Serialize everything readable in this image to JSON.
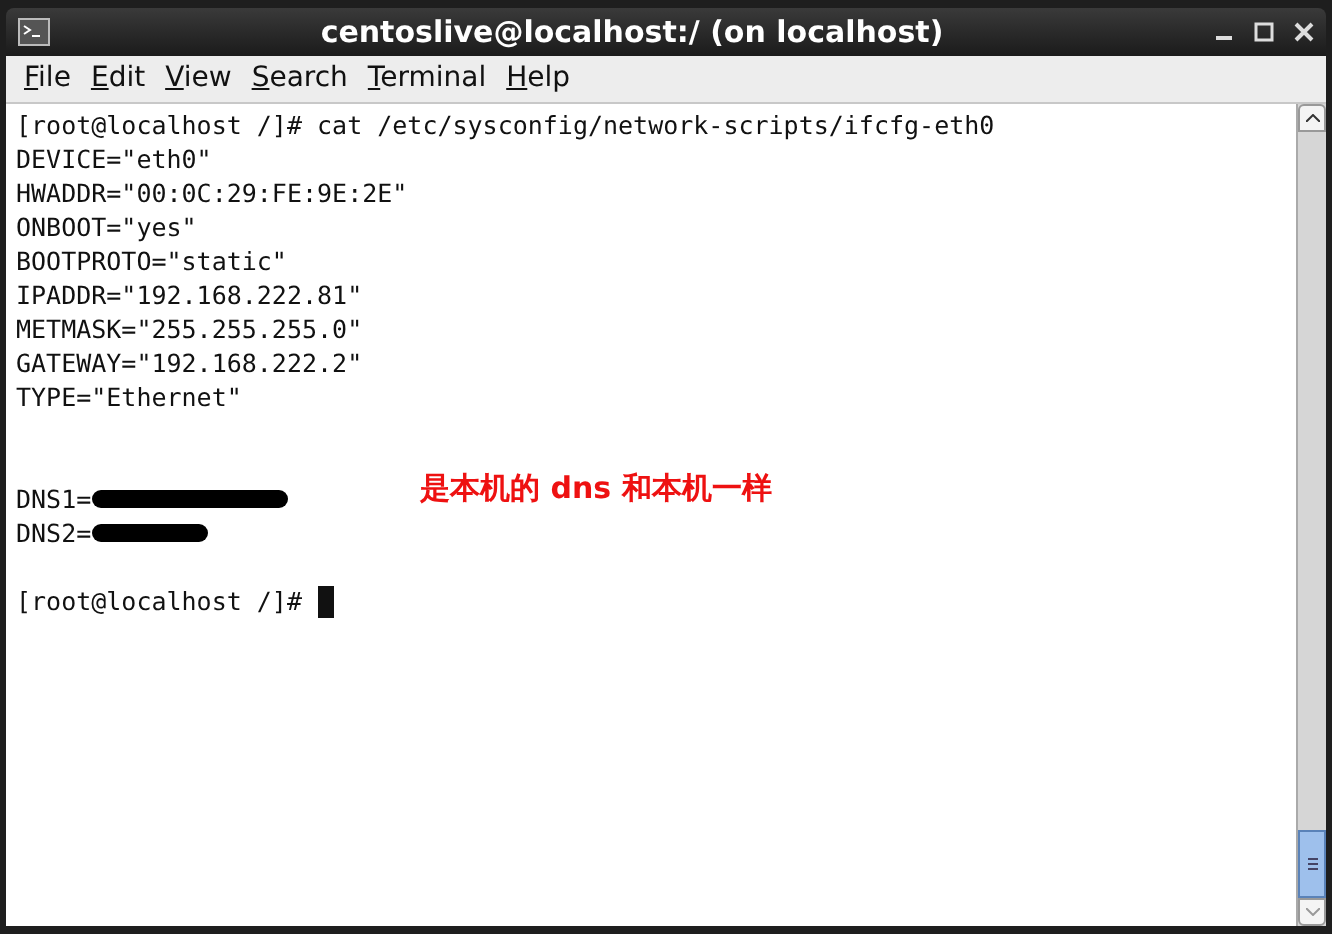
{
  "window": {
    "title": "centoslive@localhost:/ (on localhost)"
  },
  "menu": [
    {
      "label": "File"
    },
    {
      "label": "Edit"
    },
    {
      "label": "View"
    },
    {
      "label": "Search"
    },
    {
      "label": "Terminal"
    },
    {
      "label": "Help"
    }
  ],
  "terminal": {
    "lines": [
      {
        "kind": "text",
        "text": "[root@localhost /]# cat /etc/sysconfig/network-scripts/ifcfg-eth0"
      },
      {
        "kind": "text",
        "text": "DEVICE=\"eth0\""
      },
      {
        "kind": "text",
        "text": "HWADDR=\"00:0C:29:FE:9E:2E\""
      },
      {
        "kind": "text",
        "text": "ONBOOT=\"yes\""
      },
      {
        "kind": "text",
        "text": "BOOTPROTO=\"static\""
      },
      {
        "kind": "text",
        "text": "IPADDR=\"192.168.222.81\""
      },
      {
        "kind": "text",
        "text": "METMASK=\"255.255.255.0\""
      },
      {
        "kind": "text",
        "text": "GATEWAY=\"192.168.222.2\""
      },
      {
        "kind": "text",
        "text": "TYPE=\"Ethernet\""
      },
      {
        "kind": "blank"
      },
      {
        "kind": "blank"
      },
      {
        "kind": "redactedlong",
        "text": "DNS1="
      },
      {
        "kind": "redactedshort",
        "text": "DNS2="
      },
      {
        "kind": "blank"
      },
      {
        "kind": "prompt",
        "text": "[root@localhost /]#",
        "cursor": true
      }
    ]
  },
  "annotation": {
    "text": "是本机的 dns 和本机一样"
  }
}
